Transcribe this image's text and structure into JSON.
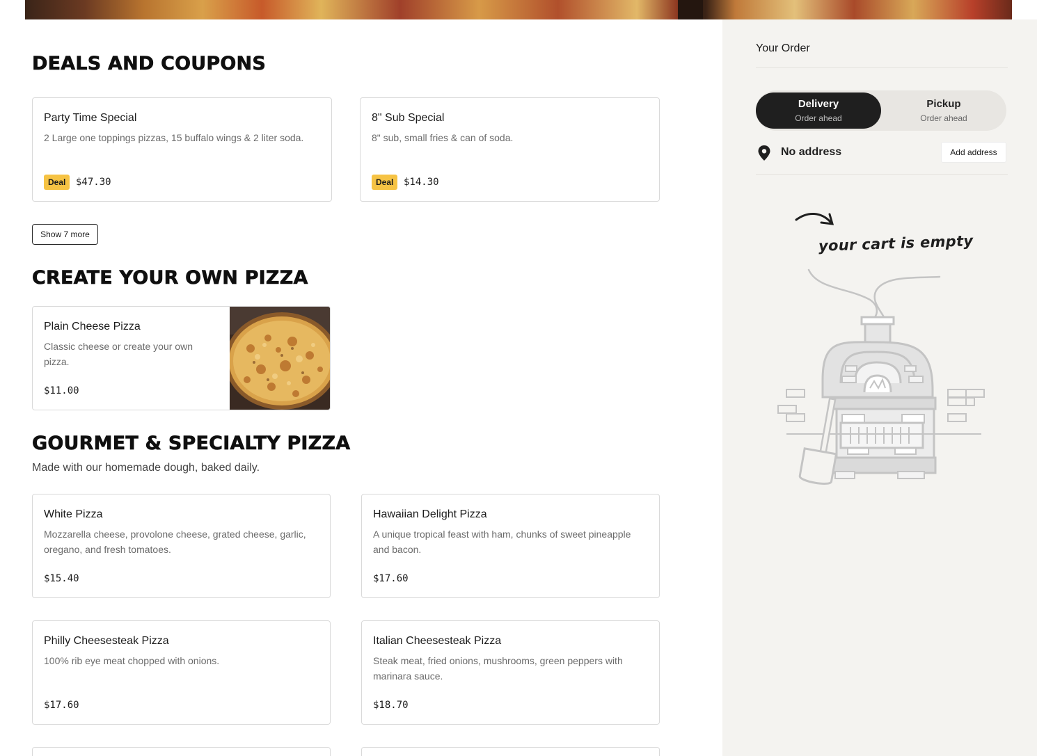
{
  "sections": {
    "deals": {
      "title": "DEALS AND COUPONS",
      "items": [
        {
          "name": "Party Time Special",
          "description": "2 Large one toppings pizzas, 15 buffalo wings & 2 liter soda.",
          "badge": "Deal",
          "price": "$47.30"
        },
        {
          "name": "8\" Sub Special",
          "description": "8\" sub, small fries & can of soda.",
          "badge": "Deal",
          "price": "$14.30"
        }
      ],
      "show_more_label": "Show 7 more"
    },
    "create": {
      "title": "CREATE YOUR OWN PIZZA",
      "items": [
        {
          "name": "Plain Cheese Pizza",
          "description": "Classic cheese or create your own pizza.",
          "price": "$11.00"
        }
      ]
    },
    "gourmet": {
      "title": "GOURMET & SPECIALTY PIZZA",
      "subtitle": "Made with our homemade dough, baked daily.",
      "items": [
        {
          "name": "White Pizza",
          "description": "Mozzarella cheese, provolone cheese, grated cheese, garlic, oregano, and fresh tomatoes.",
          "price": "$15.40"
        },
        {
          "name": "Hawaiian Delight Pizza",
          "description": "A unique tropical feast with ham, chunks of sweet pineapple and bacon.",
          "price": "$17.60"
        },
        {
          "name": "Philly Cheesesteak Pizza",
          "description": "100% rib eye meat chopped with onions.",
          "price": "$17.60"
        },
        {
          "name": "Italian Cheesesteak Pizza",
          "description": "Steak meat, fried onions, mushrooms, green peppers with marinara sauce.",
          "price": "$18.70"
        }
      ]
    }
  },
  "order": {
    "title": "Your Order",
    "modes": [
      {
        "label": "Delivery",
        "sub": "Order ahead",
        "active": true
      },
      {
        "label": "Pickup",
        "sub": "Order ahead",
        "active": false
      }
    ],
    "address_text": "No address",
    "add_address_label": "Add address",
    "empty_message": "your cart is empty"
  },
  "colors": {
    "badge": "#f6c344",
    "toggle_active": "#1f1f1f",
    "sidebar_bg": "#f4f3f0"
  },
  "icons": {
    "address": "map-pin-icon",
    "arrow": "curved-arrow-icon",
    "illustration": "pizza-oven-illustration"
  }
}
